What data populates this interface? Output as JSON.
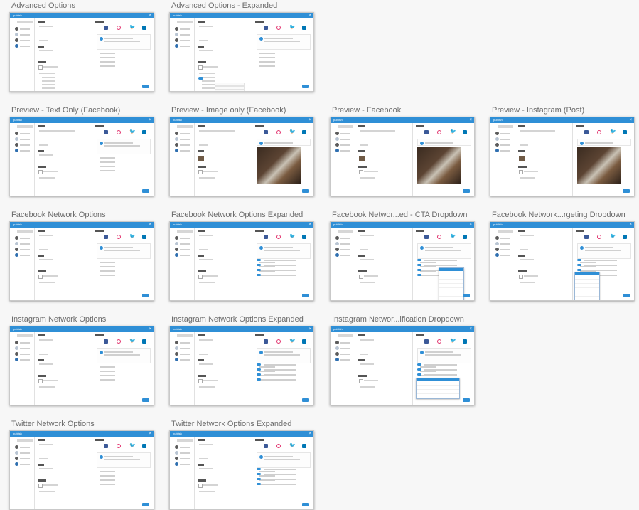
{
  "window_title_text": "publish",
  "thumbnails": [
    {
      "label": "Advanced Options",
      "variant": "advanced"
    },
    {
      "label": "Advanced Options - Expanded",
      "variant": "advanced-expanded"
    },
    {
      "label": "Preview - Text Only (Facebook)",
      "variant": "text-only"
    },
    {
      "label": "Preview - Image only (Facebook)",
      "variant": "image-only"
    },
    {
      "label": "Preview - Facebook",
      "variant": "facebook"
    },
    {
      "label": "Preview - Instagram (Post)",
      "variant": "instagram-post"
    },
    {
      "label": "Facebook Network Options",
      "variant": "fb-options"
    },
    {
      "label": "Facebook Network Options Expanded",
      "variant": "fb-expanded"
    },
    {
      "label": "Facebook Networ...ed - CTA Dropdown",
      "variant": "fb-cta"
    },
    {
      "label": "Facebook Network...rgeting Dropdown",
      "variant": "fb-targeting"
    },
    {
      "label": "Instagram Network Options",
      "variant": "ig-options"
    },
    {
      "label": "Instagram Network Options Expanded",
      "variant": "ig-expanded"
    },
    {
      "label": "Instagram Networ...ification Dropdown",
      "variant": "ig-notification"
    },
    {
      "label": "Twitter Network Options",
      "variant": "tw-options"
    },
    {
      "label": "Twitter Network Options Expanded",
      "variant": "tw-expanded"
    }
  ],
  "colors": {
    "accent": "#2f8fd6",
    "facebook": "#3b5998",
    "instagram": "#e1306c",
    "twitter": "#1da1f2",
    "linkedin": "#0077b5"
  }
}
